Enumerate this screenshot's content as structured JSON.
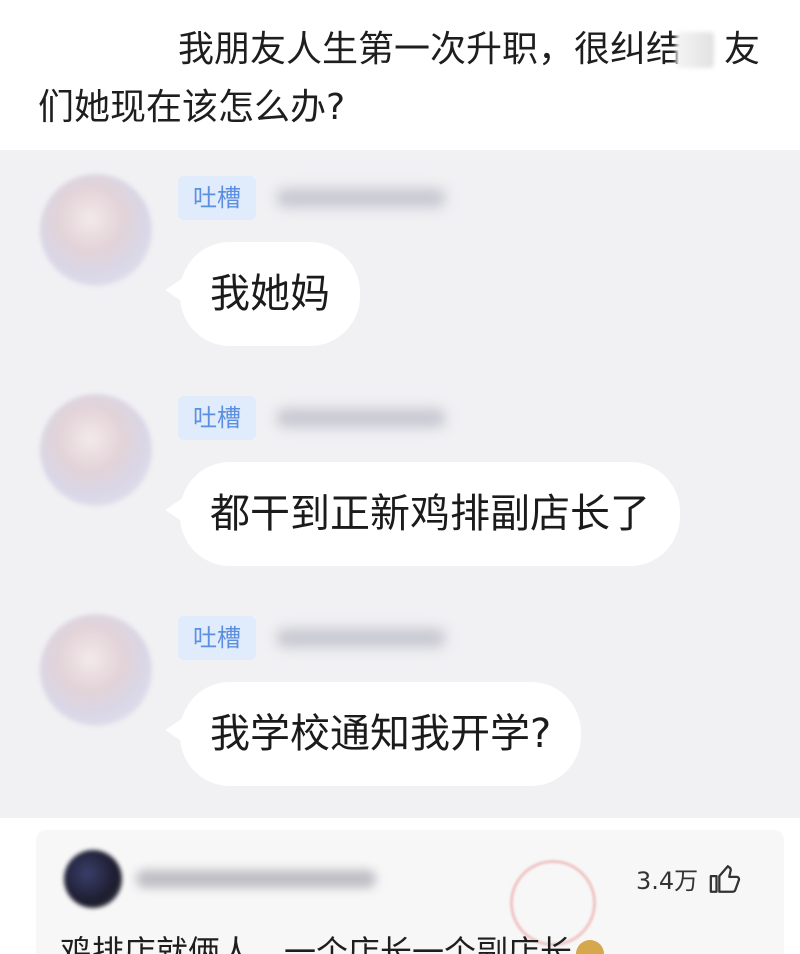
{
  "post": {
    "line1": "我朋友人生第一次升职，很纠结",
    "line1_tail": "友",
    "line2": "们她现在该怎么办?"
  },
  "messages": [
    {
      "tag": "吐槽",
      "text": "我她妈"
    },
    {
      "tag": "吐槽",
      "text": "都干到正新鸡排副店长了"
    },
    {
      "tag": "吐槽",
      "text": "我学校通知我开学?"
    }
  ],
  "comment": {
    "likes": "3.4万",
    "text": "鸡排店就俩人，一个店长一个副店长",
    "like_icon": "thumb-up-icon"
  },
  "colors": {
    "chat_bg": "#f1f1f4",
    "tag_bg": "#e0ebfb",
    "tag_text": "#5d8fe0",
    "bubble_bg": "#ffffff"
  }
}
